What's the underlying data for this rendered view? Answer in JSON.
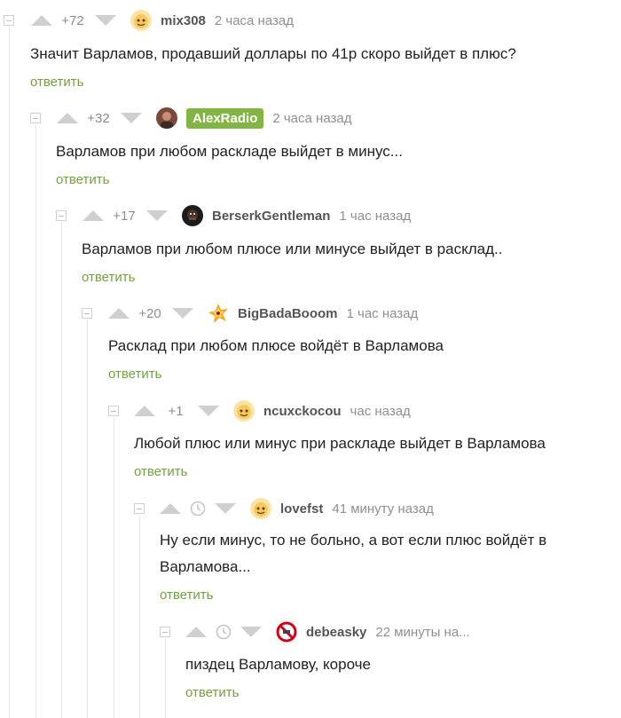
{
  "colors": {
    "accent": "#71a33c",
    "badge": "#82b544",
    "muted": "#8c8c8c",
    "arrow": "#cfcfcf"
  },
  "comments": [
    {
      "rating": "+72",
      "author": "mix308",
      "time": "2 часа назад",
      "text": "Значит Варламов, продавший доллары по 41р скоро выйдет в плюс?",
      "reply": "ответить",
      "avatar_icon": "cartoon-face-icon"
    },
    {
      "rating": "+32",
      "author": "AlexRadio",
      "time": "2 часа назад",
      "text": "Варламов при любом раскладе выйдет в минус...",
      "reply": "ответить",
      "avatar_icon": "photo-avatar-icon"
    },
    {
      "rating": "+17",
      "author": "BerserkGentleman",
      "time": "1 час назад",
      "text": "Варламов при любом плюсе или минусе выйдет в расклад..",
      "reply": "ответить",
      "avatar_icon": "dark-face-avatar-icon"
    },
    {
      "rating": "+20",
      "author": "BigBadaBooom",
      "time": "1 час назад",
      "text": "Расклад при любом плюсе войдёт в Варламова",
      "reply": "ответить",
      "avatar_icon": "explosion-avatar-icon"
    },
    {
      "rating": "+1",
      "author": "ncuxckocou",
      "time": "час назад",
      "text": "Любой плюс или минус при раскладе выйдет в Варламова",
      "reply": "ответить",
      "avatar_icon": "cartoon-face-icon"
    },
    {
      "rating": "",
      "author": "lovefst",
      "time": "41 минуту назад",
      "text": "Ну если минус, то не больно, а вот если плюс войдёт в\nВарламова...",
      "reply": "ответить",
      "avatar_icon": "cartoon-face-icon"
    },
    {
      "rating": "",
      "author": "debeasky",
      "time": "22 минуты на...",
      "text": "пиздец Варламову, короче",
      "reply": "ответить",
      "avatar_icon": "no-symbol-avatar-icon"
    }
  ]
}
